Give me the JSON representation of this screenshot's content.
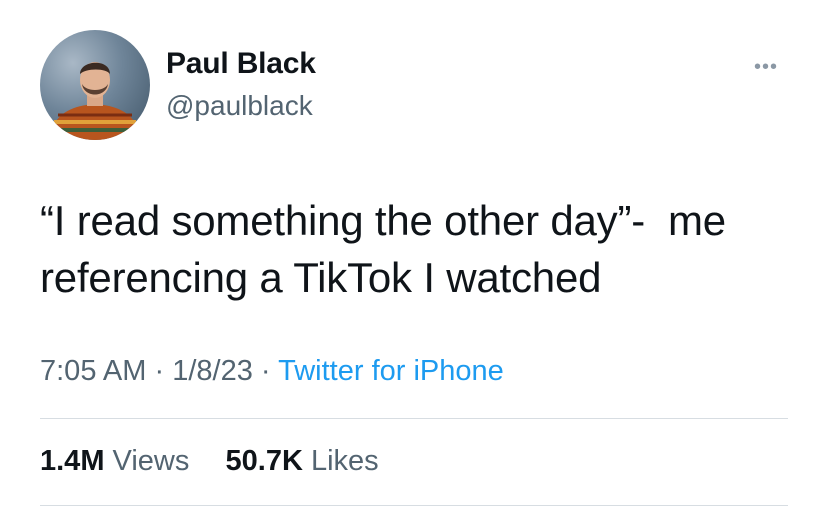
{
  "author": {
    "name": "Paul Black",
    "handle": "@paulblack"
  },
  "tweet": {
    "text": "“I read something the other day”-  me referencing a TikTok I watched"
  },
  "meta": {
    "time": "7:05 AM",
    "separator": "·",
    "date": "1/8/23",
    "source": "Twitter for iPhone"
  },
  "stats": {
    "views_count": "1.4M",
    "views_label": "Views",
    "likes_count": "50.7K",
    "likes_label": "Likes"
  },
  "icons": {
    "more": "more-options-icon"
  },
  "colors": {
    "text": "#0f1419",
    "secondary": "#536471",
    "link": "#1d9bf0",
    "divider": "#d7dde2"
  }
}
